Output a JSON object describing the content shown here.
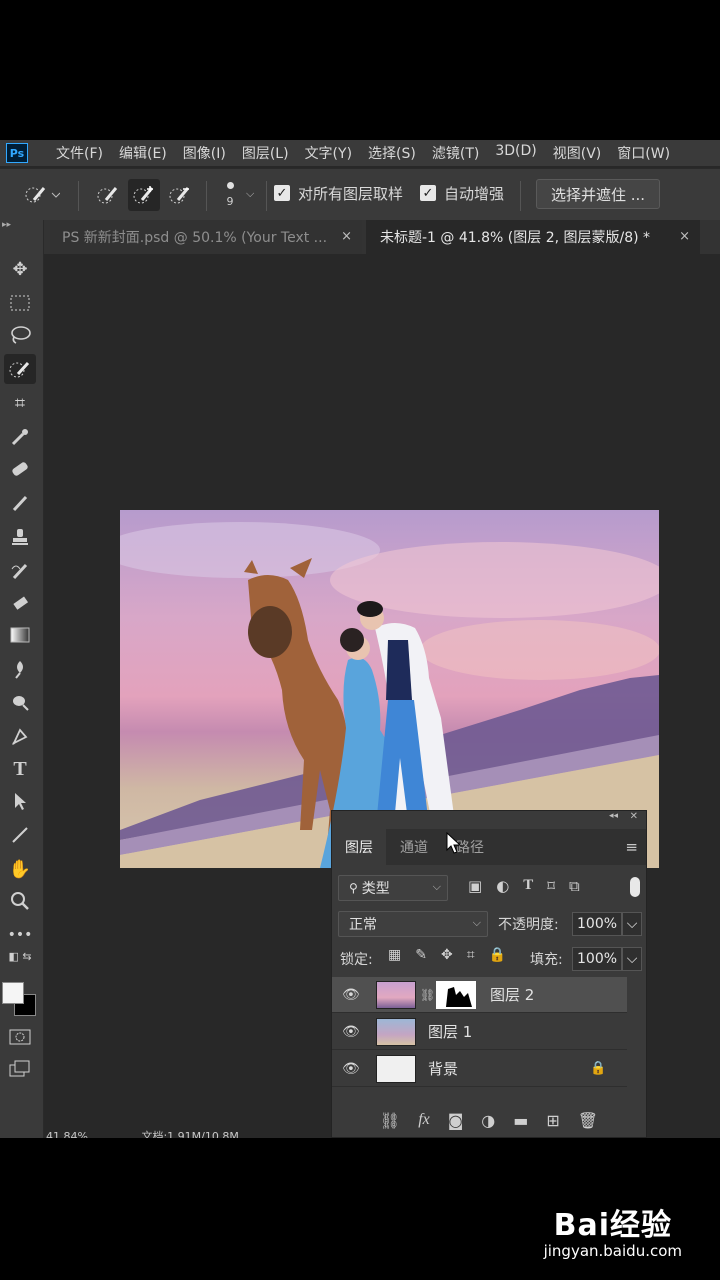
{
  "app": {
    "logo_text": "Ps"
  },
  "menu": {
    "items": [
      "文件(F)",
      "编辑(E)",
      "图像(I)",
      "图层(L)",
      "文字(Y)",
      "选择(S)",
      "滤镜(T)",
      "3D(D)",
      "视图(V)",
      "窗口(W)"
    ]
  },
  "options": {
    "brush_size": "9",
    "sample_all_layers_label": "对所有图层取样",
    "sample_all_layers_checked": true,
    "auto_enhance_label": "自动增强",
    "auto_enhance_checked": true,
    "select_and_mask_label": "选择并遮住 ..."
  },
  "tabs": [
    {
      "label": "PS 新新封面.psd @ 50.1% (Your Text ...",
      "close": "×"
    },
    {
      "label": "未标题-1 @ 41.8% (图层 2, 图层蒙版/8) *",
      "close": "×"
    }
  ],
  "toolbar": {
    "tools": [
      "move-tool",
      "marquee-tool",
      "lasso-tool",
      "quick-selection-tool",
      "crop-tool",
      "eyedropper-tool",
      "healing-brush-tool",
      "brush-tool",
      "clone-stamp-tool",
      "history-brush-tool",
      "eraser-tool",
      "gradient-tool",
      "blur-tool",
      "dodge-tool",
      "pen-tool",
      "type-tool",
      "path-selection-tool",
      "line-tool",
      "hand-tool",
      "zoom-tool",
      "more-tools"
    ]
  },
  "layers_panel": {
    "tabs": [
      "图层",
      "通道",
      "路径"
    ],
    "filter_label": "类型",
    "blend_mode": "正常",
    "opacity_label": "不透明度:",
    "opacity_value": "100%",
    "lock_label": "锁定:",
    "fill_label": "填充:",
    "fill_value": "100%",
    "layers": [
      {
        "name": "图层 2",
        "selected": true,
        "has_mask": true
      },
      {
        "name": "图层 1",
        "selected": false,
        "has_mask": false
      },
      {
        "name": "背景",
        "selected": false,
        "locked": true
      }
    ]
  },
  "status": {
    "zoom": "41.84%",
    "doc": "文档:1.91M/10.8M"
  },
  "watermark": {
    "logo": "Bai经验",
    "url": "jingyan.baidu.com"
  },
  "colors": {
    "accent": "#31a8ff",
    "panel": "#3a3a3a",
    "canvas": "#282828"
  }
}
